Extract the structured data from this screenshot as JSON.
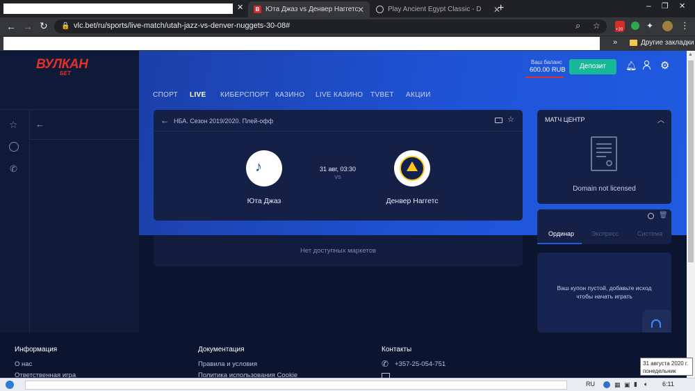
{
  "browser": {
    "tabs": [
      {
        "title": "",
        "favicon": "redacted"
      },
      {
        "title": "Юта Джаз vs Денвер Наггетс В",
        "favicon": "vulkan-b-icon",
        "active": true
      },
      {
        "title": "Play Ancient Egypt Classic - Dur",
        "favicon": "globe-icon"
      }
    ],
    "url": "vlc.bet/ru/sports/live-match/utah-jazz-vs-denver-nuggets-30-08#",
    "bookmarks_other": "Другие закладки",
    "extension_badge": "+20"
  },
  "site": {
    "logo_main": "ВУЛКАН",
    "logo_sub": "БЕТ",
    "balance_label": "Ваш баланс",
    "balance_value": "600.00 RUB",
    "deposit_label": "Депозит",
    "nav": [
      "СПОРТ",
      "LIVE",
      "КИБЕРСПОРТ",
      "КАЗИНО",
      "LIVE КАЗИНО",
      "TVBET",
      "АКЦИИ"
    ]
  },
  "match": {
    "league": "НБА. Сезон 2019/2020. Плей-офф",
    "team_home": "Юта Джаз",
    "team_away": "Денвер Наггетс",
    "datetime": "31 авг, 03:30",
    "vs": "VS",
    "no_markets": "Нет доступных маркетов"
  },
  "match_center": {
    "title": "МАТЧ ЦЕНТР",
    "license_text": "Domain not licensed"
  },
  "betslip": {
    "tabs": [
      "Ординар",
      "Экспресс",
      "Система"
    ],
    "empty_line1": "Ваш купон пустой, добавьте исход",
    "empty_line2": "чтобы начать играть"
  },
  "footer": {
    "col1_title": "Информация",
    "col1_items": [
      "О нас",
      "Ответственная игра"
    ],
    "col2_title": "Документация",
    "col2_items": [
      "Правила и условия",
      "Политика использования Cookie"
    ],
    "col3_title": "Контакты",
    "phone": "+357-25-054-751"
  },
  "taskbar": {
    "lang": "RU",
    "time": "6:11",
    "tooltip_line1": "31 августа 2020 г.",
    "tooltip_line2": "понедельник"
  },
  "colors": {
    "accent_teal": "#17b897",
    "brand_red": "#e0312a",
    "header_blue": "#1f53d6",
    "card_bg": "#142046"
  }
}
